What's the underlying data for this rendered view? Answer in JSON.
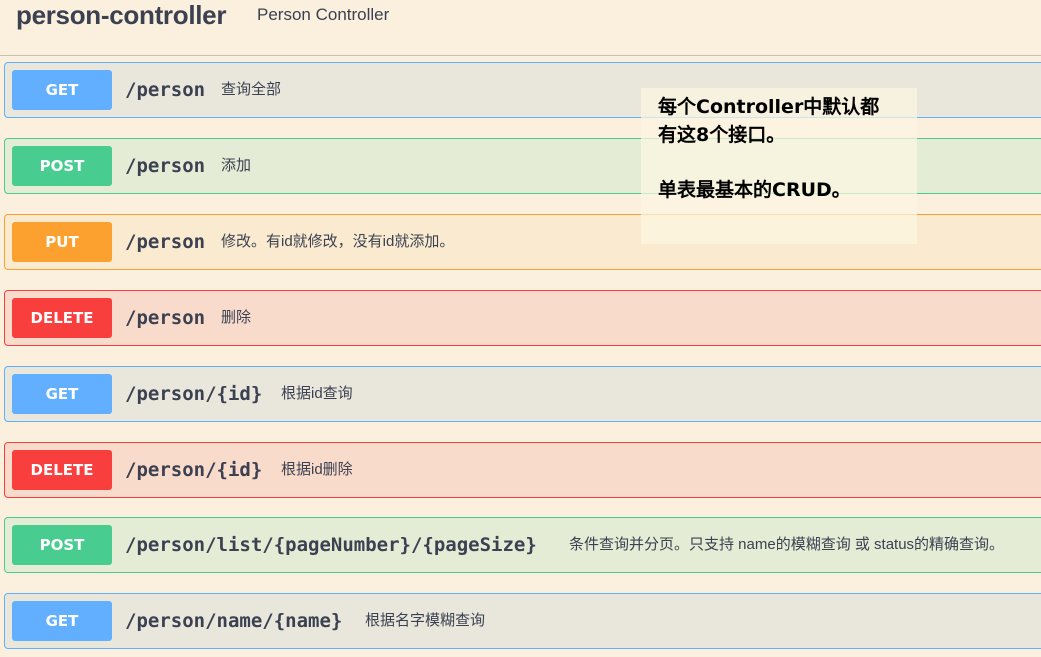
{
  "tag": {
    "name": "person-controller",
    "description": "Person Controller"
  },
  "operations": [
    {
      "method": "GET",
      "path": "/person",
      "summary": "查询全部"
    },
    {
      "method": "POST",
      "path": "/person",
      "summary": "添加"
    },
    {
      "method": "PUT",
      "path": "/person",
      "summary": "修改。有id就修改，没有id就添加。"
    },
    {
      "method": "DELETE",
      "path": "/person",
      "summary": "删除"
    },
    {
      "method": "GET",
      "path": "/person/{id}",
      "summary": "根据id查询"
    },
    {
      "method": "DELETE",
      "path": "/person/{id}",
      "summary": "根据id删除"
    },
    {
      "method": "POST",
      "path": "/person/list/{pageNumber}/{pageSize}",
      "summary": "条件查询并分页。只支持 name的模糊查询 或 status的精确查询。"
    },
    {
      "method": "GET",
      "path": "/person/name/{name}",
      "summary": "根据名字模糊查询"
    }
  ],
  "annotation": {
    "line1": "每个Controller中默认都",
    "line2": "有这8个接口。",
    "line3": "单表最基本的CRUD。"
  },
  "colors": {
    "get": "#61affe",
    "post": "#49cc90",
    "put": "#fca130",
    "delete": "#f93e3e",
    "text": "#3b4151"
  }
}
